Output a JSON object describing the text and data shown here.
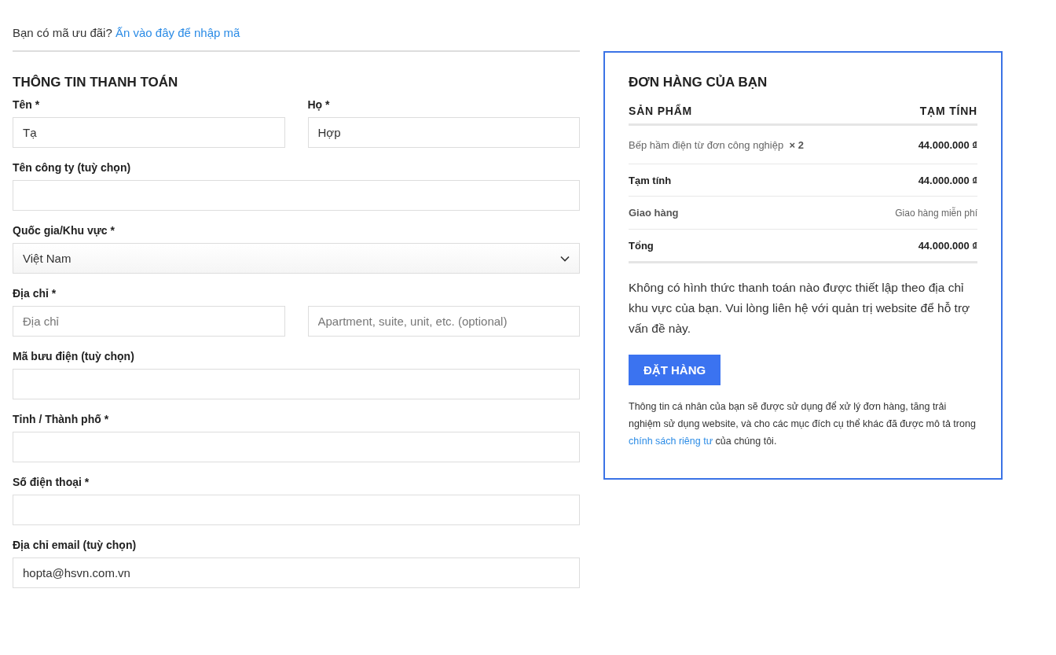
{
  "coupon": {
    "text": "Bạn có mã ưu đãi?",
    "link": "Ấn vào đây để nhập mã"
  },
  "billing": {
    "title": "THÔNG TIN THANH TOÁN",
    "rows": [
      {
        "fields": [
          {
            "label": "Tên *",
            "kind": "text",
            "value": "Tạ"
          },
          {
            "label": "Họ *",
            "kind": "text",
            "value": "Hợp"
          }
        ]
      },
      {
        "fields": [
          {
            "label": "Tên công ty (tuỳ chọn)",
            "kind": "text"
          }
        ]
      },
      {
        "fields": [
          {
            "label": "Quốc gia/Khu vực *",
            "kind": "select",
            "value": "Việt Nam"
          }
        ]
      },
      {
        "label": "Địa chỉ *",
        "fields": [
          {
            "kind": "text",
            "placeholder": "Địa chỉ"
          },
          {
            "kind": "text",
            "placeholder": "Apartment, suite, unit, etc. (optional)"
          }
        ]
      },
      {
        "fields": [
          {
            "label": "Mã bưu điện (tuỳ chọn)",
            "kind": "text"
          }
        ]
      },
      {
        "fields": [
          {
            "label": "Tỉnh / Thành phố *",
            "kind": "text"
          }
        ]
      },
      {
        "fields": [
          {
            "label": "Số điện thoại *",
            "kind": "text"
          }
        ]
      },
      {
        "fields": [
          {
            "label": "Địa chỉ email (tuỳ chọn)",
            "kind": "text",
            "value": "hopta@hsvn.com.vn"
          }
        ]
      }
    ]
  },
  "order": {
    "title": "ĐƠN HÀNG CỦA BẠN",
    "columns": [
      "SẢN PHẨM",
      "TẠM TÍNH"
    ],
    "rows": [
      {
        "kind": "item",
        "label": "Bếp hầm điện từ đơn công nghiệp",
        "quantity": "× 2",
        "amount": "44.000.000 ₫"
      },
      {
        "kind": "subtotal",
        "label": "Tạm tính",
        "amount": "44.000.000 ₫"
      },
      {
        "kind": "shipping",
        "label": "Giao hàng",
        "amount": "Giao hàng miễn phí"
      },
      {
        "kind": "total",
        "label": "Tổng",
        "amount": "44.000.000 ₫"
      }
    ],
    "notice": "Không có hình thức thanh toán nào được thiết lập theo địa chỉ khu vực của bạn. Vui lòng liên hệ với quản trị website để hỗ trợ vấn đề này.",
    "button": "ĐẶT HÀNG",
    "privacy": {
      "before": "Thông tin cá nhân của bạn sẽ được sử dụng để xử lý đơn hàng, tăng trải nghiệm sử dụng website, và cho các mục đích cụ thể khác đã được mô tả trong",
      "link": "chính sách riêng tư",
      "after": "của chúng tôi."
    }
  }
}
